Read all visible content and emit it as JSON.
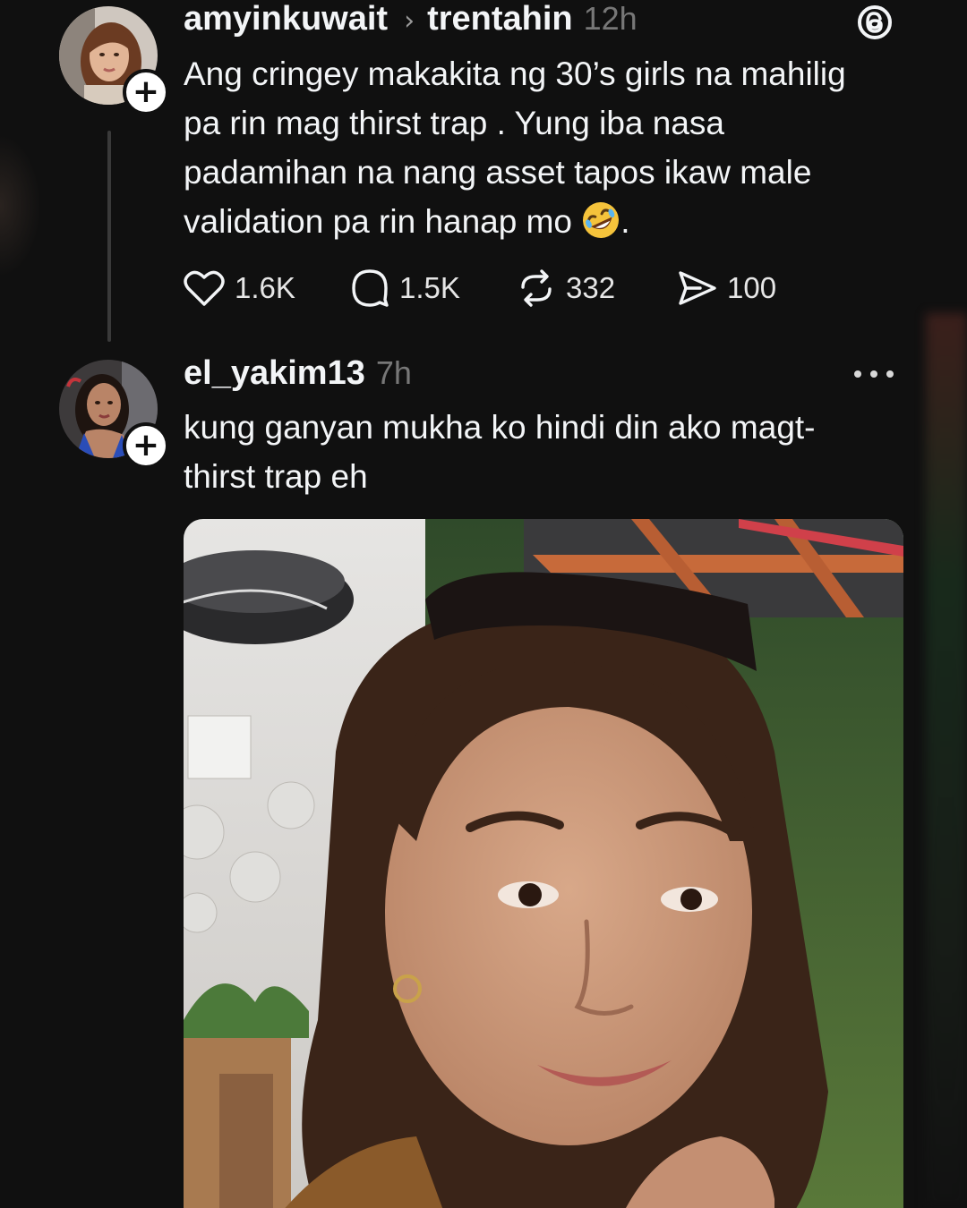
{
  "app": {
    "logo_icon": "threads-logo-icon"
  },
  "post1": {
    "username": "amyinkuwait",
    "reply_to_separator": "›",
    "reply_to_user": "trentahin",
    "time": "12h",
    "text_before_emoji": "Ang cringey makakita ng 30’s girls na mahilig\npa rin mag thirst trap . Yung iba nasa\npadamihan na nang asset tapos ikaw male\nvalidation pa rin hanap mo ",
    "emoji_name": "rolling-on-the-floor-laughing-emoji",
    "text_after_emoji": ".",
    "follow_symbol": "+",
    "stats": {
      "likes": "1.6K",
      "replies": "1.5K",
      "reposts": "332",
      "shares": "100"
    }
  },
  "post2": {
    "username": "el_yakim13",
    "time": "7h",
    "text": "kung ganyan mukha ko hindi din ako magt-\nthirst trap eh",
    "follow_symbol": "+",
    "media_description_icon": "selfie-photo"
  },
  "colors": {
    "background": "#101010",
    "text_primary": "#f3f5f7",
    "text_secondary": "#777777",
    "thread_line": "#3a3a3a"
  }
}
